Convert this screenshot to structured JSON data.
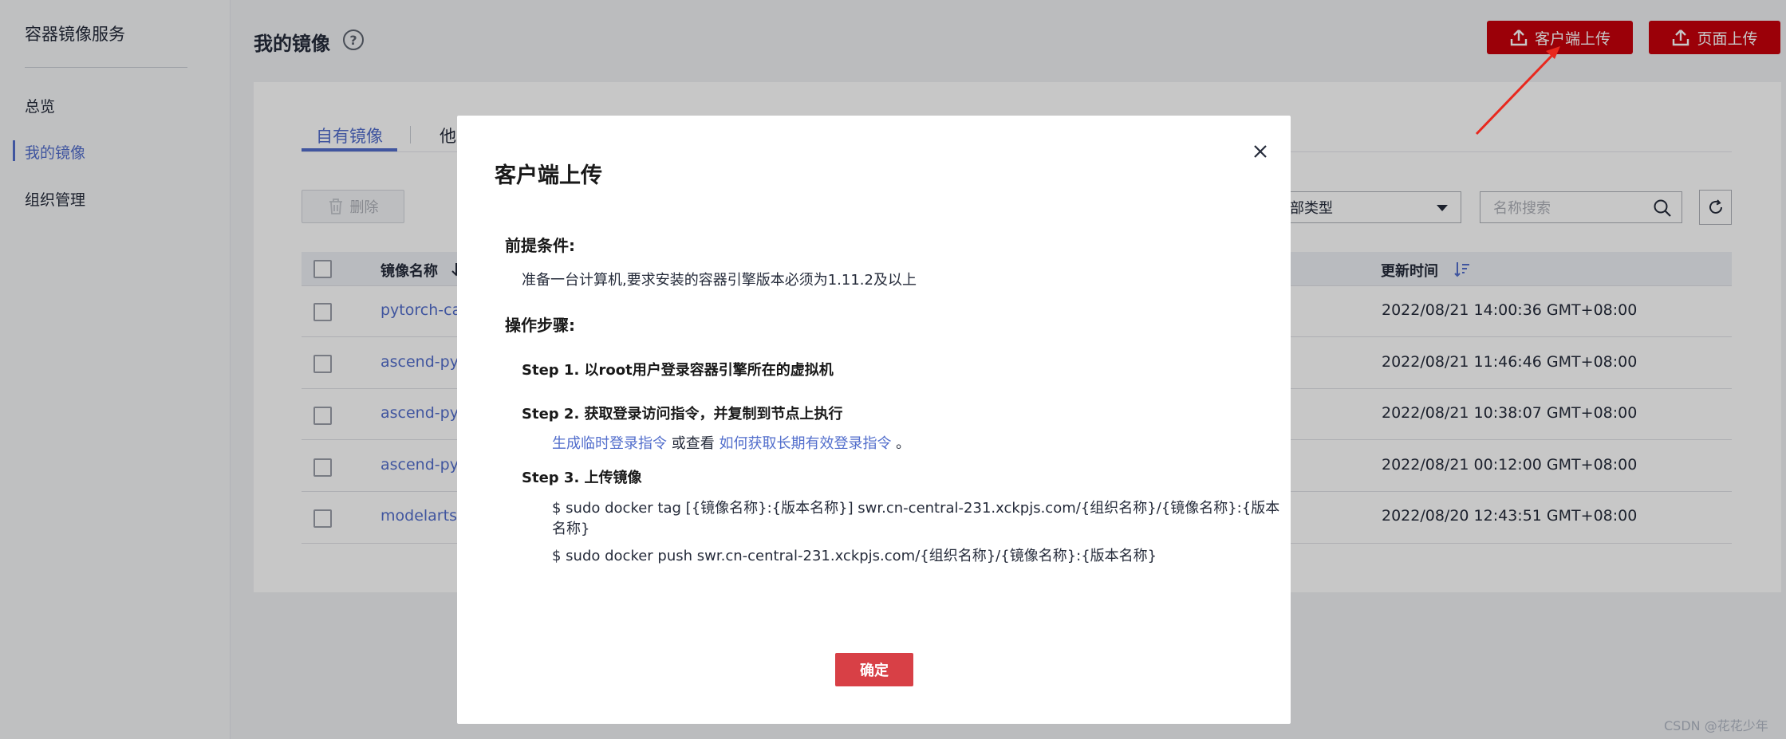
{
  "sidebar": {
    "title": "容器镜像服务",
    "items": [
      {
        "label": "总览"
      },
      {
        "label": "我的镜像"
      },
      {
        "label": "组织管理"
      }
    ]
  },
  "header": {
    "title": "我的镜像",
    "help": "?",
    "client_upload_label": "客户端上传",
    "page_upload_label": "页面上传"
  },
  "tabs": [
    {
      "label": "自有镜像"
    },
    {
      "label": "他"
    }
  ],
  "toolbar": {
    "delete_label": "删除",
    "type_select_value": "部类型",
    "search_placeholder": "名称搜索"
  },
  "table": {
    "columns": [
      "镜像名称",
      "更新时间"
    ],
    "rows": [
      {
        "name": "pytorch-ca",
        "time": "2022/08/21 14:00:36 GMT+08:00"
      },
      {
        "name": "ascend-pyt",
        "time": "2022/08/21 11:46:46 GMT+08:00"
      },
      {
        "name": "ascend-pyt",
        "time": "2022/08/21 10:38:07 GMT+08:00"
      },
      {
        "name": "ascend-pyt",
        "time": "2022/08/21 00:12:00 GMT+08:00"
      },
      {
        "name": "modelarts-",
        "time": "2022/08/20 12:43:51 GMT+08:00"
      }
    ]
  },
  "modal": {
    "title": "客户端上传",
    "prereq_heading": "前提条件:",
    "prereq_text": "准备一台计算机,要求安装的容器引擎版本必须为1.11.2及以上",
    "steps_heading": "操作步骤:",
    "step1": "Step 1. 以root用户登录容器引擎所在的虚拟机",
    "step2": "Step 2. 获取登录访问指令，并复制到节点上执行",
    "step2_link1": "生成临时登录指令",
    "step2_mid": " 或查看 ",
    "step2_link2": "如何获取长期有效登录指令",
    "step2_end": " 。",
    "step3": "Step 3. 上传镜像",
    "cmd1_line1": "$ sudo docker tag [{镜像名称}:{版本名称}] swr.cn-central-231.xckpjs.com/{组织名称}/{镜像名称}:{版本",
    "cmd1_line2": "名称}",
    "cmd2": "$ sudo docker push swr.cn-central-231.xckpjs.com/{组织名称}/{镜像名称}:{版本名称}",
    "ok_label": "确定"
  },
  "watermark": "CSDN @花花少年",
  "colors": {
    "brand_red": "#c7000b",
    "link_blue": "#526ecc",
    "confirm_red": "#d84046",
    "annotation_arrow": "#e8281e"
  }
}
